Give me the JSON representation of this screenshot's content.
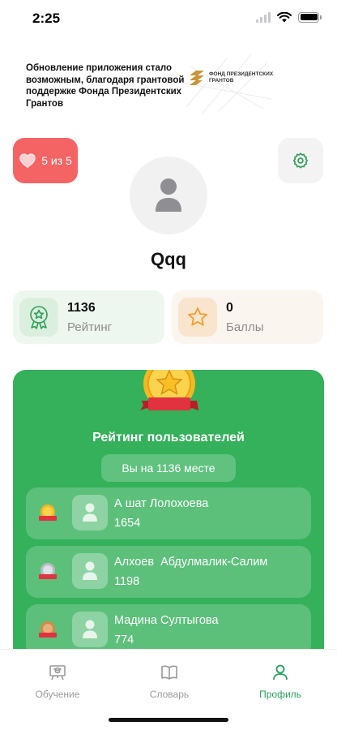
{
  "status_bar": {
    "time": "2:25"
  },
  "banner": {
    "text": "Обновление приложения стало возможным, благодаря грантовой поддержке Фонда Президентских Грантов",
    "logo_text": "ФОНД ПРЕЗИДЕНТСКИХ ГРАНТОВ"
  },
  "lives": {
    "label": "5 из 5"
  },
  "profile": {
    "username": "Qqq"
  },
  "stats": {
    "rating": {
      "value": "1136",
      "label": "Рейтинг"
    },
    "points": {
      "value": "0",
      "label": "Баллы"
    }
  },
  "leaderboard": {
    "title": "Рейтинг пользователей",
    "your_place": "Вы на 1136 месте",
    "rows": [
      {
        "rank": "1",
        "medal": "gold",
        "name": "А шат Лолохоева",
        "score": "1654"
      },
      {
        "rank": "2",
        "medal": "silver",
        "name": "Алхоев  Абдулмалик-Салим",
        "score": "1198"
      },
      {
        "rank": "3",
        "medal": "bronze",
        "name": "Мадина Султыгова",
        "score": "774"
      }
    ]
  },
  "tabs": [
    {
      "label": "Обучение",
      "icon": "learning-icon",
      "active": false
    },
    {
      "label": "Словарь",
      "icon": "book-icon",
      "active": false
    },
    {
      "label": "Профиль",
      "icon": "profile-icon",
      "active": true
    }
  ],
  "colors": {
    "accent_green": "#34b15a",
    "active_tab": "#27a25a",
    "lives_red": "#f46464"
  }
}
